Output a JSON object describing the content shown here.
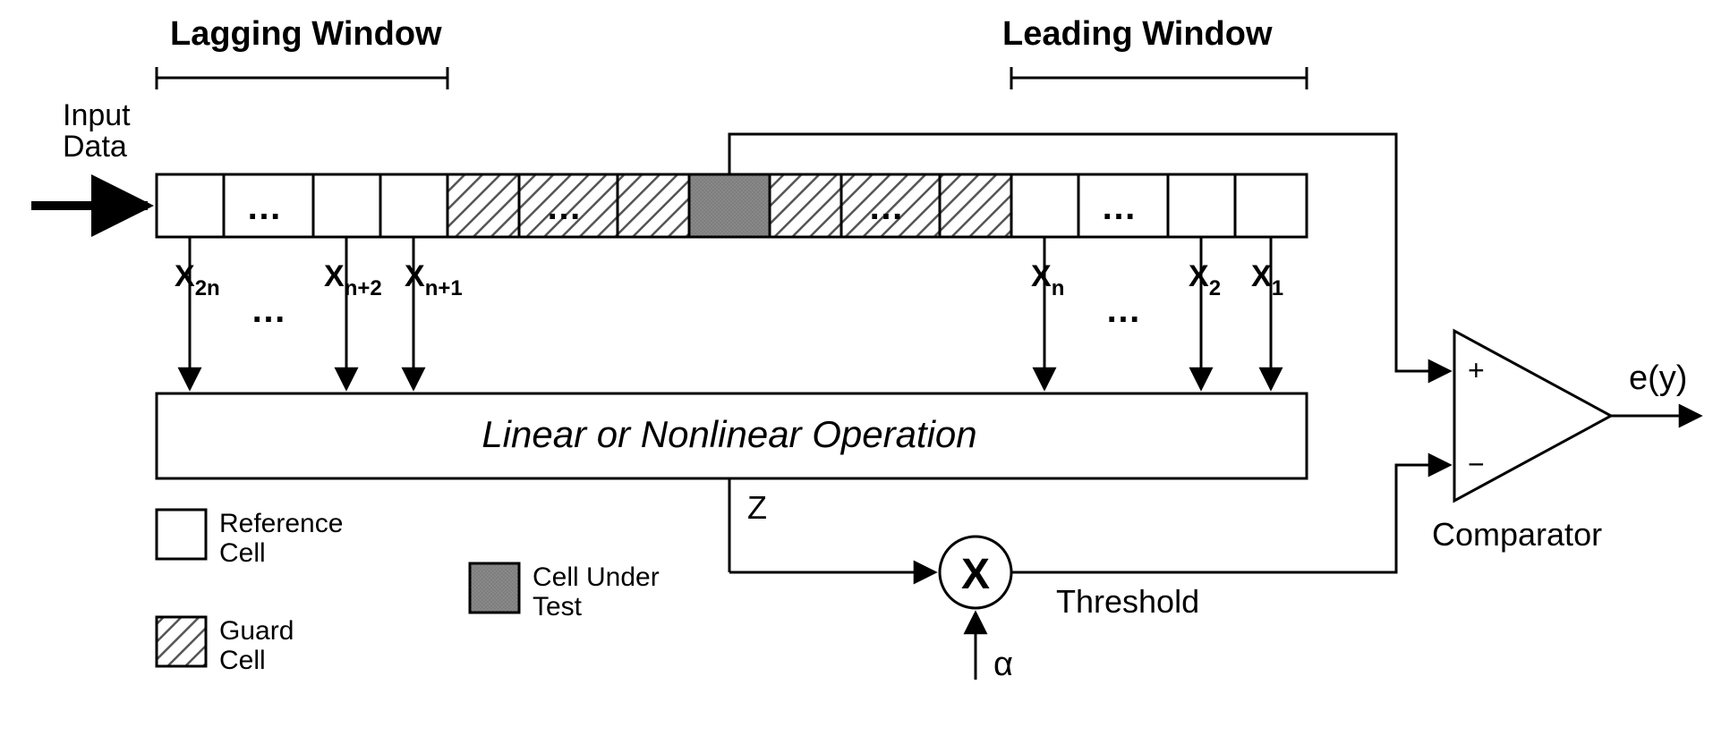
{
  "labels": {
    "lagging_window": "Lagging Window",
    "leading_window": "Leading Window",
    "input_data_l1": "Input",
    "input_data_l2": "Data",
    "operation": "Linear or Nonlinear Operation",
    "z": "Z",
    "alpha": "α",
    "threshold": "Threshold",
    "comparator": "Comparator",
    "output": "e(y)",
    "plus": "+",
    "minus": "−",
    "x_2n": "X",
    "x_2n_sub": "2n",
    "x_n2": "X",
    "x_n2_sub": "n+2",
    "x_n1": "X",
    "x_n1_sub": "n+1",
    "x_n": "X",
    "x_n_sub": "n",
    "x_2": "X",
    "x_2_sub": "2",
    "x_1": "X",
    "x_1_sub": "1",
    "dots": "…",
    "dots2": "…",
    "dots_lag_between": "…",
    "dots_lead_between": "…",
    "dots_cells_lag": "…",
    "dots_cells_gL": "…",
    "dots_cells_gR": "…",
    "dots_cells_lead": "…",
    "legend_ref": "Reference",
    "legend_ref2": "Cell",
    "legend_guard": "Guard",
    "legend_guard2": "Cell",
    "legend_cut": "Cell Under",
    "legend_cut2": "Test",
    "mult": "X"
  }
}
